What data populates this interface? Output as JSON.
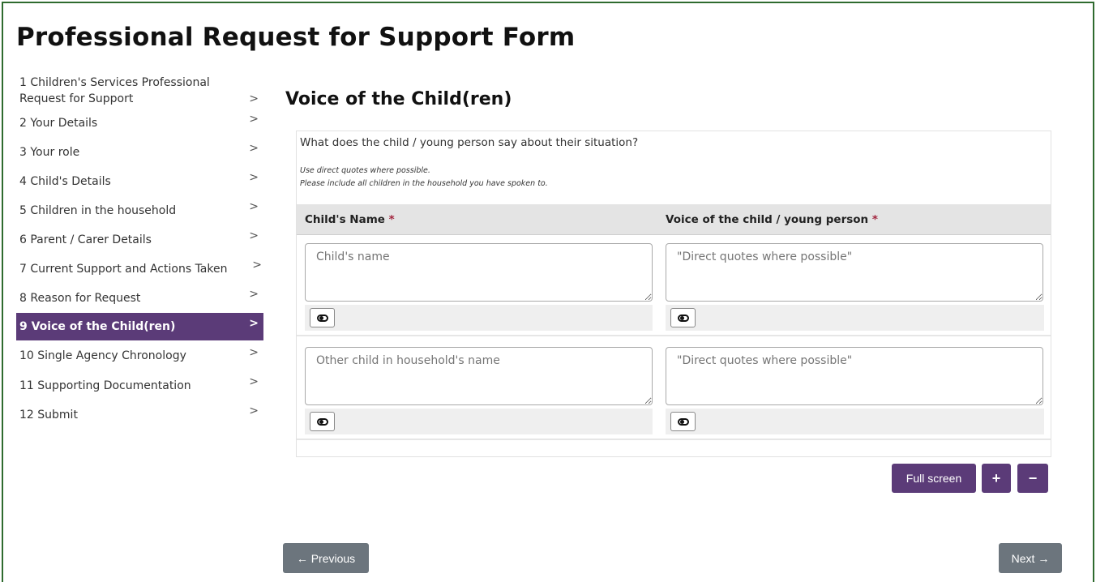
{
  "page_title": "Professional Request for Support Form",
  "sidebar": {
    "items": [
      {
        "label": "1 Children's Services Professional Request for Support",
        "chevron": ">"
      },
      {
        "label": "2 Your Details",
        "chevron": ">"
      },
      {
        "label": "3 Your role",
        "chevron": ">"
      },
      {
        "label": "4 Child's Details",
        "chevron": ">"
      },
      {
        "label": "5 Children in the household",
        "chevron": ">"
      },
      {
        "label": "6 Parent / Carer Details",
        "chevron": ">"
      },
      {
        "label": "7 Current Support and Actions Taken",
        "chevron": ">"
      },
      {
        "label": "8 Reason for Request",
        "chevron": ">"
      },
      {
        "label": "9 Voice of the Child(ren)",
        "chevron": ">",
        "active": true
      },
      {
        "label": "10 Single Agency Chronology",
        "chevron": ">"
      },
      {
        "label": "11 Supporting Documentation",
        "chevron": ">"
      },
      {
        "label": "12 Submit",
        "chevron": ">"
      }
    ]
  },
  "main": {
    "section_title": "Voice of the Child(ren)",
    "question": "What does the child / young person say about their situation?",
    "hints": [
      "Use direct quotes where possible.",
      "Please include all children in the household you have spoken to."
    ],
    "columns": [
      {
        "label": "Child's Name",
        "required_mark": "*"
      },
      {
        "label": "Voice of the child / young person",
        "required_mark": "*"
      }
    ],
    "rows": [
      {
        "name_placeholder": "Child's name",
        "voice_placeholder": "\"Direct quotes where possible\""
      },
      {
        "name_placeholder": "Other child in household's name",
        "voice_placeholder": "\"Direct quotes where possible\""
      }
    ],
    "toggle_icon": "eye-toggle-icon"
  },
  "table_controls": {
    "fullscreen_label": "Full screen",
    "add_label": "+",
    "remove_label": "−"
  },
  "footer": {
    "previous_label": "← Previous",
    "next_label": "Next →"
  },
  "colors": {
    "accent": "#5b3b78",
    "frame_border": "#2f6b2f",
    "required": "#a2243d",
    "nav_button": "#6c757d"
  }
}
